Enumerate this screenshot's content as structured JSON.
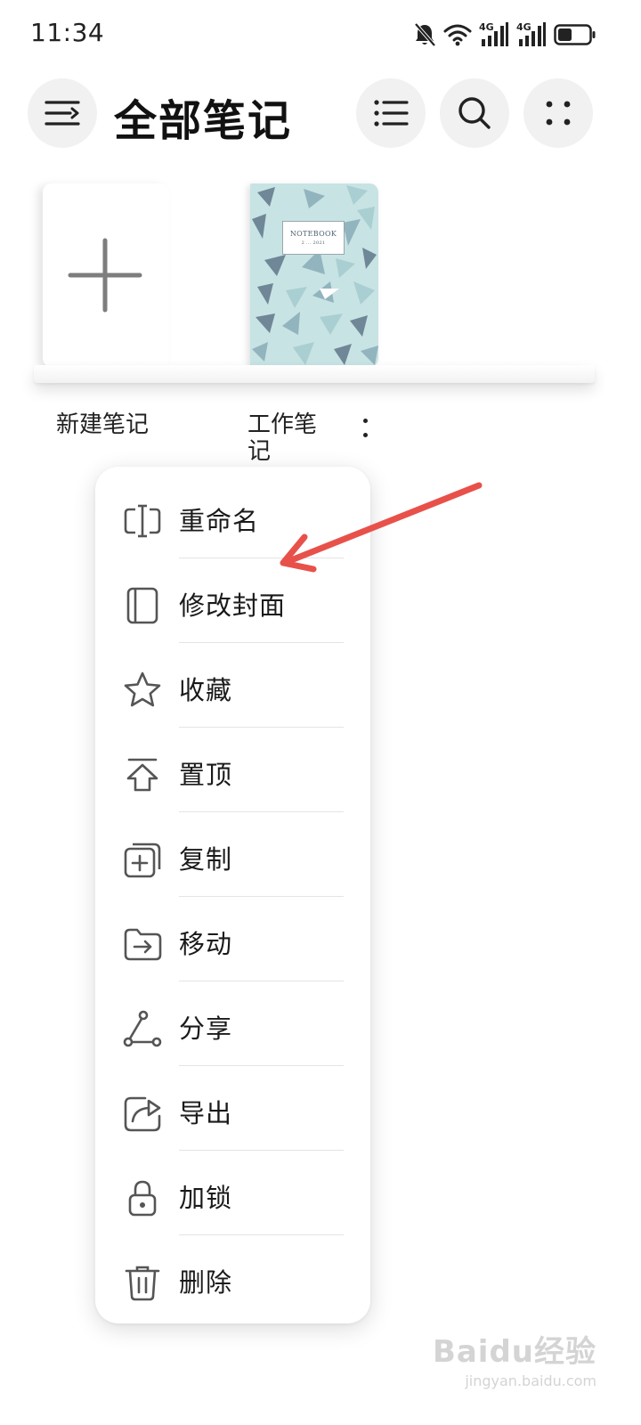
{
  "status_bar": {
    "time": "11:34",
    "network_label_1": "4G",
    "network_label_2": "4G",
    "icons": [
      "bell-off-icon",
      "wifi-icon",
      "signal-4g-icon",
      "signal-4g-icon",
      "battery-icon"
    ],
    "battery_level": 0.45
  },
  "header": {
    "title": "全部笔记",
    "icons": [
      "menu-icon",
      "list-view-icon",
      "search-icon",
      "more-icon"
    ]
  },
  "shelf": {
    "new_note_label": "新建笔记",
    "notebook_title": "工作笔记",
    "cover_title": "NOTEBOOK",
    "cover_subtitle": "2 ... 2021",
    "cover_palette": [
      "#c8e3e3",
      "#6f8797",
      "#92b4be",
      "#a9cfd2"
    ]
  },
  "context_menu": {
    "items": [
      {
        "label": "重命名",
        "icon": "rename-icon"
      },
      {
        "label": "修改封面",
        "icon": "cover-icon"
      },
      {
        "label": "收藏",
        "icon": "star-icon"
      },
      {
        "label": "置顶",
        "icon": "pin-top-icon"
      },
      {
        "label": "复制",
        "icon": "copy-icon"
      },
      {
        "label": "移动",
        "icon": "move-folder-icon"
      },
      {
        "label": "分享",
        "icon": "share-icon"
      },
      {
        "label": "导出",
        "icon": "export-icon"
      },
      {
        "label": "加锁",
        "icon": "lock-icon"
      },
      {
        "label": "删除",
        "icon": "trash-icon"
      }
    ]
  },
  "annotation": {
    "arrow_color": "#e8514a"
  },
  "watermark": {
    "main": "Baidu经验",
    "sub": "jingyan.baidu.com"
  }
}
